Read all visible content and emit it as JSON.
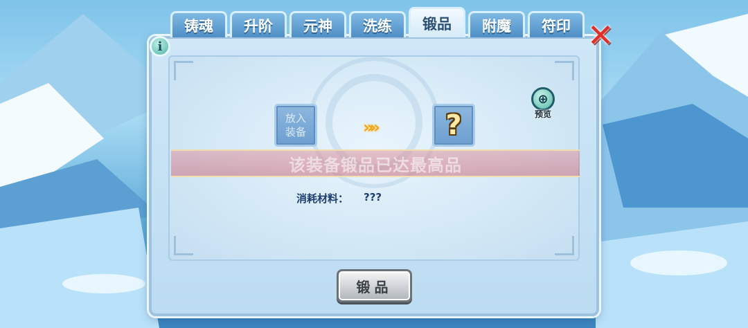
{
  "tabs": [
    {
      "label": "铸魂",
      "active": false
    },
    {
      "label": "升阶",
      "active": false
    },
    {
      "label": "元神",
      "active": false
    },
    {
      "label": "洗练",
      "active": false
    },
    {
      "label": "锻品",
      "active": true
    },
    {
      "label": "附魔",
      "active": false
    },
    {
      "label": "符印",
      "active": false
    }
  ],
  "info_icon": "info-icon",
  "close_icon": "close-icon",
  "input_slot": {
    "label": "放入\n装备"
  },
  "output_slot": {
    "symbol": "?"
  },
  "arrow_symbol": "»»",
  "preview": {
    "label": "预览",
    "icon": "magnifier-plus-icon"
  },
  "banner": {
    "text": "该装备锻品已达最高品"
  },
  "cost": {
    "label": "消耗材料：",
    "value": "???"
  },
  "action_button": {
    "label": "锻品"
  },
  "colors": {
    "accent": "#4f8fc6",
    "close": "#e0302a",
    "arrow": "#f3a31c"
  }
}
